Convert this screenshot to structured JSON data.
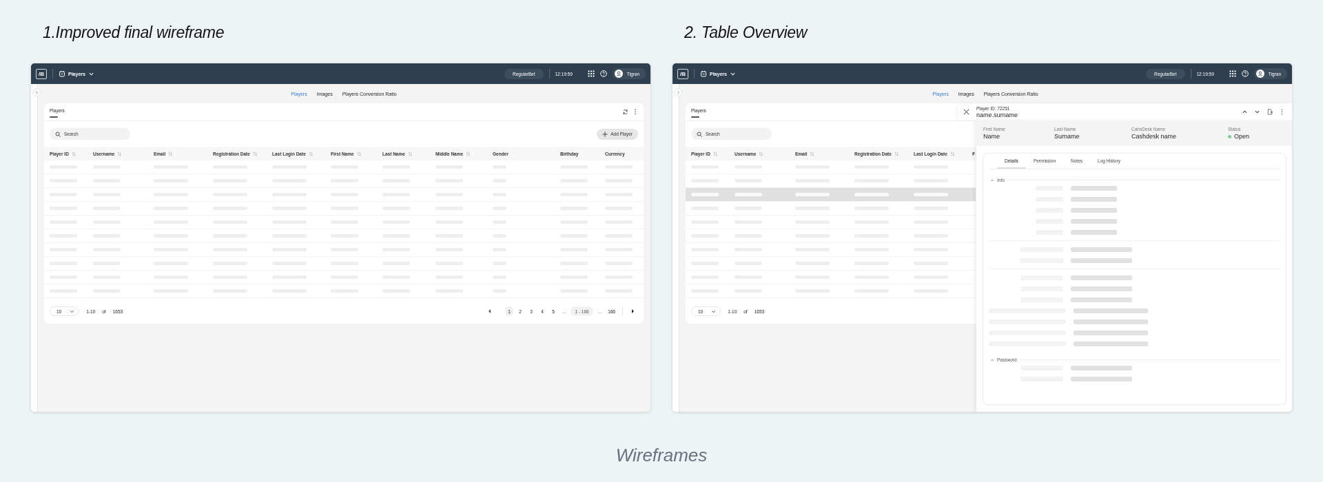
{
  "frames": [
    {
      "title": "1.Improved final wireframe",
      "topbar": {
        "logo": "/B",
        "module": "Players",
        "brand": "RegularBet",
        "time": "12:19:59",
        "user": "Tigran"
      },
      "tabs": [
        {
          "label": "Players",
          "selected": true
        },
        {
          "label": "Images",
          "selected": false
        },
        {
          "label": "Players Conversion Ratio",
          "selected": false
        }
      ],
      "card": {
        "title": "Players",
        "search": {
          "placeholder": "Search"
        },
        "add_button": "Add Player",
        "columns": [
          {
            "label": "Player ID",
            "sortable": true
          },
          {
            "label": "Username",
            "sortable": true
          },
          {
            "label": "Email",
            "sortable": true
          },
          {
            "label": "Registration Date",
            "sortable": true
          },
          {
            "label": "Last Login Date",
            "sortable": true
          },
          {
            "label": "First Name",
            "sortable": true
          },
          {
            "label": "Last Name",
            "sortable": true
          },
          {
            "label": "Middle Name",
            "sortable": true
          },
          {
            "label": "Gender",
            "sortable": false
          },
          {
            "label": "Birthday",
            "sortable": false
          },
          {
            "label": "Currency",
            "sortable": false
          }
        ],
        "rows": [
          {
            "selected": false
          },
          {
            "selected": false
          },
          {
            "selected": false
          },
          {
            "selected": false
          },
          {
            "selected": false
          },
          {
            "selected": false
          },
          {
            "selected": false
          },
          {
            "selected": false
          },
          {
            "selected": false
          },
          {
            "selected": false
          }
        ],
        "pagination": {
          "page_size": "10",
          "range": "1-10",
          "of": "of",
          "total": "1653",
          "pages": [
            {
              "kind": "prev"
            },
            {
              "kind": "page",
              "label": "1",
              "selected": true
            },
            {
              "kind": "page",
              "label": "2",
              "selected": false
            },
            {
              "kind": "page",
              "label": "3",
              "selected": false
            },
            {
              "kind": "page",
              "label": "4",
              "selected": false
            },
            {
              "kind": "page",
              "label": "5",
              "selected": false
            },
            {
              "kind": "ellipsis",
              "label": "..."
            },
            {
              "kind": "jump",
              "label": "1 - 166"
            },
            {
              "kind": "ellipsis",
              "label": "..."
            },
            {
              "kind": "page",
              "label": "166",
              "selected": false
            },
            {
              "kind": "next"
            }
          ]
        }
      }
    },
    {
      "title": "2. Table Overview",
      "topbar": {
        "logo": "/B",
        "module": "Players",
        "brand": "RegularBet",
        "time": "12:19:59",
        "user": "Tigran"
      },
      "tabs": [
        {
          "label": "Players",
          "selected": true
        },
        {
          "label": "Images",
          "selected": false
        },
        {
          "label": "Players Conversion Ratio",
          "selected": false
        }
      ],
      "card": {
        "title": "Players",
        "search": {
          "placeholder": "Search"
        },
        "columns": [
          {
            "label": "Player ID",
            "sortable": true
          },
          {
            "label": "Username",
            "sortable": true
          },
          {
            "label": "Email",
            "sortable": true
          },
          {
            "label": "Registration Date",
            "sortable": true
          },
          {
            "label": "Last Login Date",
            "sortable": true
          },
          {
            "label": "F"
          }
        ],
        "rows": [
          {
            "selected": false
          },
          {
            "selected": false
          },
          {
            "selected": true
          },
          {
            "selected": false
          },
          {
            "selected": false
          },
          {
            "selected": false
          },
          {
            "selected": false
          },
          {
            "selected": false
          },
          {
            "selected": false
          },
          {
            "selected": false
          }
        ],
        "pagination": {
          "page_size": "10",
          "range": "1-10",
          "of": "of",
          "total": "1653"
        }
      },
      "detail_panel": {
        "id_label": "Player ID: 72251",
        "name": "name.surname",
        "fields": [
          {
            "label": "First Name",
            "value": "Name"
          },
          {
            "label": "Last Name",
            "value": "Surname"
          },
          {
            "label": "CahsDesk Name",
            "value": "Cashdesk name"
          },
          {
            "label": "Status",
            "value": "Open",
            "color": "#7dcf9a"
          }
        ],
        "tabs": [
          {
            "label": "Details",
            "selected": true
          },
          {
            "label": "Permission",
            "selected": false
          },
          {
            "label": "Notes",
            "selected": false
          },
          {
            "label": "Log History",
            "selected": false
          }
        ],
        "sections": [
          {
            "title": "Info",
            "expanded": true
          },
          {
            "title": "Password",
            "expanded": true
          }
        ]
      }
    }
  ],
  "caption": "Wireframes"
}
